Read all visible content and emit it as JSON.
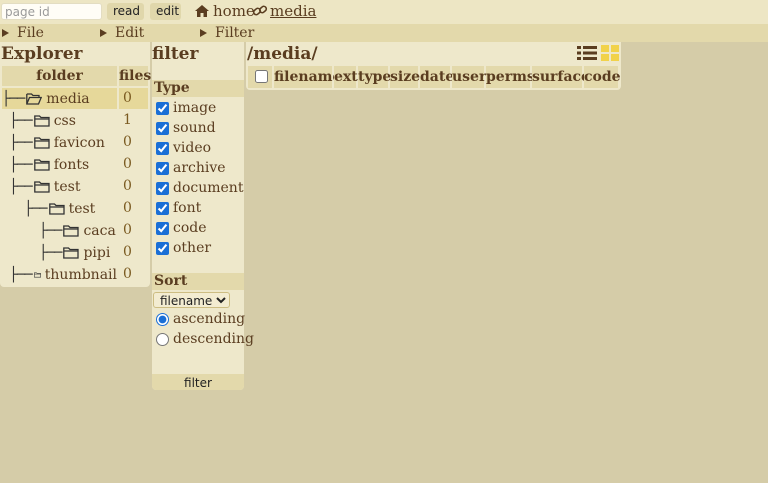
{
  "topbar": {
    "page_id_placeholder": "page id",
    "read_label": "read",
    "edit_label": "edit",
    "home_label": "home",
    "media_label": "media"
  },
  "menus": {
    "file": "File",
    "edit": "Edit",
    "filter": "Filter"
  },
  "explorer": {
    "title": "Explorer",
    "col_folder": "folder",
    "col_files": "files",
    "rows": [
      {
        "prefix": "├──",
        "name": "media",
        "files": "0",
        "open": true,
        "selected": true
      },
      {
        "prefix": " ├──",
        "name": "css",
        "files": "1"
      },
      {
        "prefix": " ├──",
        "name": "favicon",
        "files": "0"
      },
      {
        "prefix": " ├──",
        "name": "fonts",
        "files": "0"
      },
      {
        "prefix": " ├──",
        "name": "test",
        "files": "0"
      },
      {
        "prefix": "   ├──",
        "name": "test",
        "files": "0"
      },
      {
        "prefix": "     ├──",
        "name": "caca",
        "files": "0"
      },
      {
        "prefix": "     ├──",
        "name": "pipi",
        "files": "0"
      },
      {
        "prefix": " ├──",
        "name": "thumbnail",
        "files": "0"
      }
    ]
  },
  "filter": {
    "title": "filter",
    "type_heading": "Type",
    "types": [
      {
        "label": "image",
        "checked": true
      },
      {
        "label": "sound",
        "checked": true
      },
      {
        "label": "video",
        "checked": true
      },
      {
        "label": "archive",
        "checked": true
      },
      {
        "label": "document",
        "checked": true
      },
      {
        "label": "font",
        "checked": true
      },
      {
        "label": "code",
        "checked": true
      },
      {
        "label": "other",
        "checked": true
      }
    ],
    "sort_heading": "Sort",
    "sort_selected": "filename",
    "order_options": [
      {
        "label": "ascending",
        "checked": true
      },
      {
        "label": "descending",
        "checked": false
      }
    ],
    "submit_label": "filter"
  },
  "main": {
    "path": "/media/",
    "columns": [
      "filename",
      "ext",
      "type",
      "size",
      "date",
      "user",
      "perms",
      "surface",
      "code"
    ]
  },
  "colors": {
    "background": "#d5cca8",
    "panel": "#eee8cb",
    "header": "#e3d9ab",
    "text": "#5a3d20",
    "selected": "#e6d89a",
    "grid_icon": "#f1d24a"
  }
}
